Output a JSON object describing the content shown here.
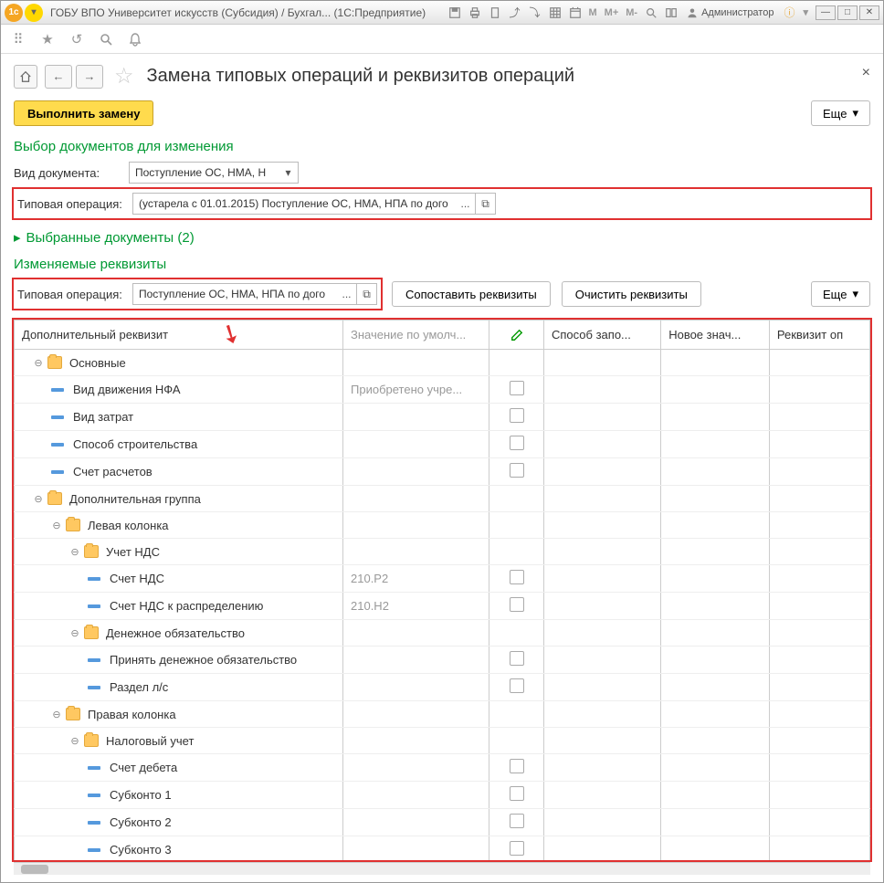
{
  "window": {
    "title": "ГОБУ ВПО Университет искусств (Субсидия) / Бухгал... (1С:Предприятие)",
    "user": "Администратор"
  },
  "page": {
    "title": "Замена типовых операций и реквизитов операций",
    "execute_btn": "Выполнить замену",
    "more_btn": "Еще"
  },
  "section1_title": "Выбор документов для изменения",
  "doc_type": {
    "label": "Вид документа:",
    "value": "Поступление ОС, НМА, Н"
  },
  "op_type1": {
    "label": "Типовая операция:",
    "value": "(устарела с 01.01.2015) Поступление ОС, НМА, НПА по дого"
  },
  "selected_docs": "Выбранные документы (2)",
  "section2_title": "Изменяемые реквизиты",
  "op_type2": {
    "label": "Типовая операция:",
    "value": "Поступление ОС, НМА, НПА по дого"
  },
  "btn_match": "Сопоставить реквизиты",
  "btn_clear": "Очистить реквизиты",
  "cols": {
    "c1": "Дополнительный реквизит",
    "c2": "Значение по умолч...",
    "c4": "Способ запо...",
    "c5": "Новое знач...",
    "c6": "Реквизит оп"
  },
  "tree": [
    {
      "level": 0,
      "type": "folder",
      "label": "Основные"
    },
    {
      "level": 1,
      "type": "leaf",
      "label": "Вид движения НФА",
      "val": "Приобретено учре...",
      "chk": true
    },
    {
      "level": 1,
      "type": "leaf",
      "label": "Вид затрат",
      "chk": true
    },
    {
      "level": 1,
      "type": "leaf",
      "label": "Способ строительства",
      "chk": true
    },
    {
      "level": 1,
      "type": "leaf",
      "label": "Счет расчетов",
      "chk": true
    },
    {
      "level": 0,
      "type": "folder",
      "label": "Дополнительная группа"
    },
    {
      "level": 1,
      "type": "folder",
      "label": "Левая колонка"
    },
    {
      "level": 2,
      "type": "folder",
      "label": "Учет НДС"
    },
    {
      "level": 3,
      "type": "leaf",
      "label": "Счет НДС",
      "val": "210.Р2",
      "chk": true
    },
    {
      "level": 3,
      "type": "leaf",
      "label": "Счет НДС к распределению",
      "val": "210.Н2",
      "chk": true
    },
    {
      "level": 2,
      "type": "folder",
      "label": "Денежное обязательство"
    },
    {
      "level": 3,
      "type": "leaf",
      "label": "Принять денежное обязательство",
      "chk": true
    },
    {
      "level": 3,
      "type": "leaf",
      "label": "Раздел л/с",
      "chk": true
    },
    {
      "level": 1,
      "type": "folder",
      "label": "Правая колонка"
    },
    {
      "level": 2,
      "type": "folder",
      "label": "Налоговый учет"
    },
    {
      "level": 3,
      "type": "leaf",
      "label": "Счет дебета",
      "chk": true
    },
    {
      "level": 3,
      "type": "leaf",
      "label": "Субконто 1",
      "chk": true
    },
    {
      "level": 3,
      "type": "leaf",
      "label": "Субконто 2",
      "chk": true
    },
    {
      "level": 3,
      "type": "leaf",
      "label": "Субконто 3",
      "chk": true
    }
  ]
}
